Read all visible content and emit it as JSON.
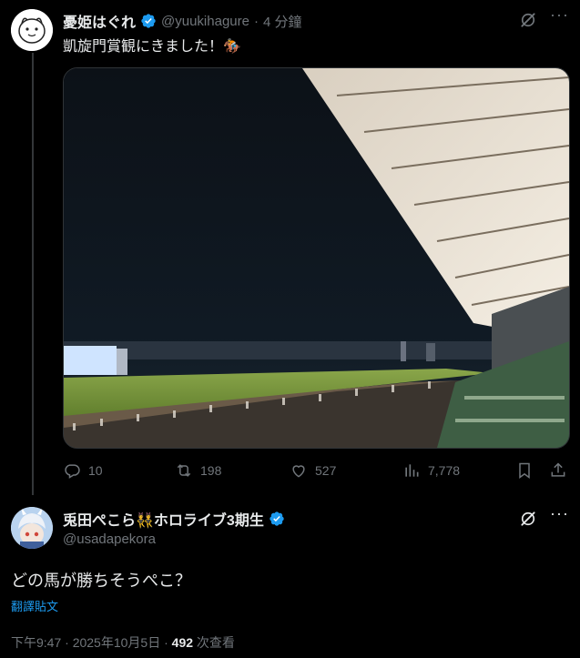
{
  "tweet1": {
    "name": "憂姫はぐれ",
    "handle": "@yuukihagure",
    "separator": "·",
    "time": "4 分鐘",
    "text": "凱旋門賞観にきました！🏇",
    "actions": {
      "replies": "10",
      "retweets": "198",
      "likes": "527",
      "views": "7,778"
    }
  },
  "tweet2": {
    "name": "兎田ぺこら👯ホロライブ3期生",
    "handle": "@usadapekora",
    "text": "どの馬が勝ちそうぺこ？",
    "translate": "翻譯貼文",
    "timestamp": "下午9:47 · 2025年10月5日",
    "dot": "·",
    "views_count": "492",
    "views_label": "次查看"
  },
  "colors": {
    "background": "#000000",
    "text": "#e7e9ea",
    "muted": "#71767b",
    "link": "#1d9bf0",
    "verified": "#1d9bf0",
    "border": "#2f3336"
  }
}
